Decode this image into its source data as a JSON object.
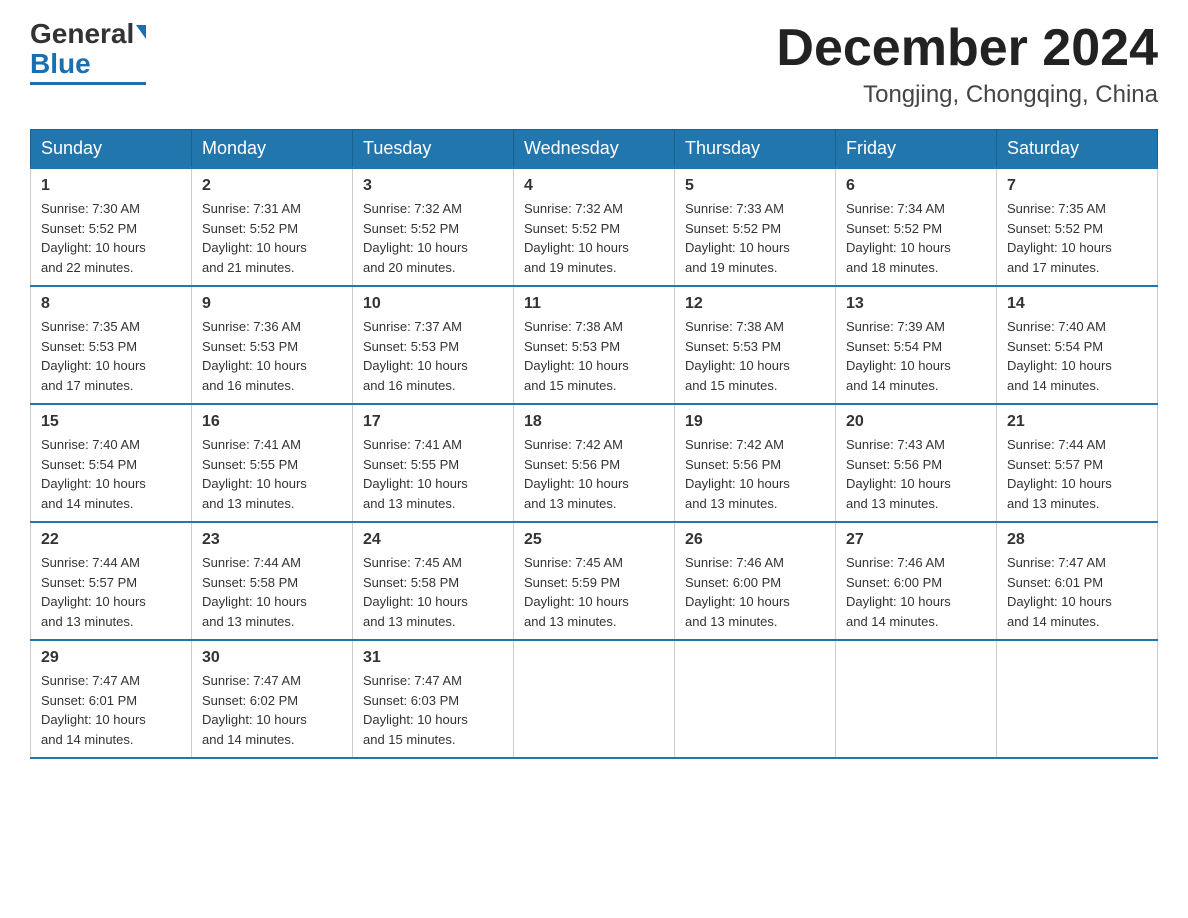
{
  "header": {
    "logo": {
      "general": "General",
      "blue": "Blue"
    },
    "title": "December 2024",
    "location": "Tongjing, Chongqing, China"
  },
  "calendar": {
    "headers": [
      "Sunday",
      "Monday",
      "Tuesday",
      "Wednesday",
      "Thursday",
      "Friday",
      "Saturday"
    ],
    "rows": [
      [
        {
          "day": "1",
          "info": "Sunrise: 7:30 AM\nSunset: 5:52 PM\nDaylight: 10 hours\nand 22 minutes."
        },
        {
          "day": "2",
          "info": "Sunrise: 7:31 AM\nSunset: 5:52 PM\nDaylight: 10 hours\nand 21 minutes."
        },
        {
          "day": "3",
          "info": "Sunrise: 7:32 AM\nSunset: 5:52 PM\nDaylight: 10 hours\nand 20 minutes."
        },
        {
          "day": "4",
          "info": "Sunrise: 7:32 AM\nSunset: 5:52 PM\nDaylight: 10 hours\nand 19 minutes."
        },
        {
          "day": "5",
          "info": "Sunrise: 7:33 AM\nSunset: 5:52 PM\nDaylight: 10 hours\nand 19 minutes."
        },
        {
          "day": "6",
          "info": "Sunrise: 7:34 AM\nSunset: 5:52 PM\nDaylight: 10 hours\nand 18 minutes."
        },
        {
          "day": "7",
          "info": "Sunrise: 7:35 AM\nSunset: 5:52 PM\nDaylight: 10 hours\nand 17 minutes."
        }
      ],
      [
        {
          "day": "8",
          "info": "Sunrise: 7:35 AM\nSunset: 5:53 PM\nDaylight: 10 hours\nand 17 minutes."
        },
        {
          "day": "9",
          "info": "Sunrise: 7:36 AM\nSunset: 5:53 PM\nDaylight: 10 hours\nand 16 minutes."
        },
        {
          "day": "10",
          "info": "Sunrise: 7:37 AM\nSunset: 5:53 PM\nDaylight: 10 hours\nand 16 minutes."
        },
        {
          "day": "11",
          "info": "Sunrise: 7:38 AM\nSunset: 5:53 PM\nDaylight: 10 hours\nand 15 minutes."
        },
        {
          "day": "12",
          "info": "Sunrise: 7:38 AM\nSunset: 5:53 PM\nDaylight: 10 hours\nand 15 minutes."
        },
        {
          "day": "13",
          "info": "Sunrise: 7:39 AM\nSunset: 5:54 PM\nDaylight: 10 hours\nand 14 minutes."
        },
        {
          "day": "14",
          "info": "Sunrise: 7:40 AM\nSunset: 5:54 PM\nDaylight: 10 hours\nand 14 minutes."
        }
      ],
      [
        {
          "day": "15",
          "info": "Sunrise: 7:40 AM\nSunset: 5:54 PM\nDaylight: 10 hours\nand 14 minutes."
        },
        {
          "day": "16",
          "info": "Sunrise: 7:41 AM\nSunset: 5:55 PM\nDaylight: 10 hours\nand 13 minutes."
        },
        {
          "day": "17",
          "info": "Sunrise: 7:41 AM\nSunset: 5:55 PM\nDaylight: 10 hours\nand 13 minutes."
        },
        {
          "day": "18",
          "info": "Sunrise: 7:42 AM\nSunset: 5:56 PM\nDaylight: 10 hours\nand 13 minutes."
        },
        {
          "day": "19",
          "info": "Sunrise: 7:42 AM\nSunset: 5:56 PM\nDaylight: 10 hours\nand 13 minutes."
        },
        {
          "day": "20",
          "info": "Sunrise: 7:43 AM\nSunset: 5:56 PM\nDaylight: 10 hours\nand 13 minutes."
        },
        {
          "day": "21",
          "info": "Sunrise: 7:44 AM\nSunset: 5:57 PM\nDaylight: 10 hours\nand 13 minutes."
        }
      ],
      [
        {
          "day": "22",
          "info": "Sunrise: 7:44 AM\nSunset: 5:57 PM\nDaylight: 10 hours\nand 13 minutes."
        },
        {
          "day": "23",
          "info": "Sunrise: 7:44 AM\nSunset: 5:58 PM\nDaylight: 10 hours\nand 13 minutes."
        },
        {
          "day": "24",
          "info": "Sunrise: 7:45 AM\nSunset: 5:58 PM\nDaylight: 10 hours\nand 13 minutes."
        },
        {
          "day": "25",
          "info": "Sunrise: 7:45 AM\nSunset: 5:59 PM\nDaylight: 10 hours\nand 13 minutes."
        },
        {
          "day": "26",
          "info": "Sunrise: 7:46 AM\nSunset: 6:00 PM\nDaylight: 10 hours\nand 13 minutes."
        },
        {
          "day": "27",
          "info": "Sunrise: 7:46 AM\nSunset: 6:00 PM\nDaylight: 10 hours\nand 14 minutes."
        },
        {
          "day": "28",
          "info": "Sunrise: 7:47 AM\nSunset: 6:01 PM\nDaylight: 10 hours\nand 14 minutes."
        }
      ],
      [
        {
          "day": "29",
          "info": "Sunrise: 7:47 AM\nSunset: 6:01 PM\nDaylight: 10 hours\nand 14 minutes."
        },
        {
          "day": "30",
          "info": "Sunrise: 7:47 AM\nSunset: 6:02 PM\nDaylight: 10 hours\nand 14 minutes."
        },
        {
          "day": "31",
          "info": "Sunrise: 7:47 AM\nSunset: 6:03 PM\nDaylight: 10 hours\nand 15 minutes."
        },
        {
          "day": "",
          "info": ""
        },
        {
          "day": "",
          "info": ""
        },
        {
          "day": "",
          "info": ""
        },
        {
          "day": "",
          "info": ""
        }
      ]
    ]
  }
}
